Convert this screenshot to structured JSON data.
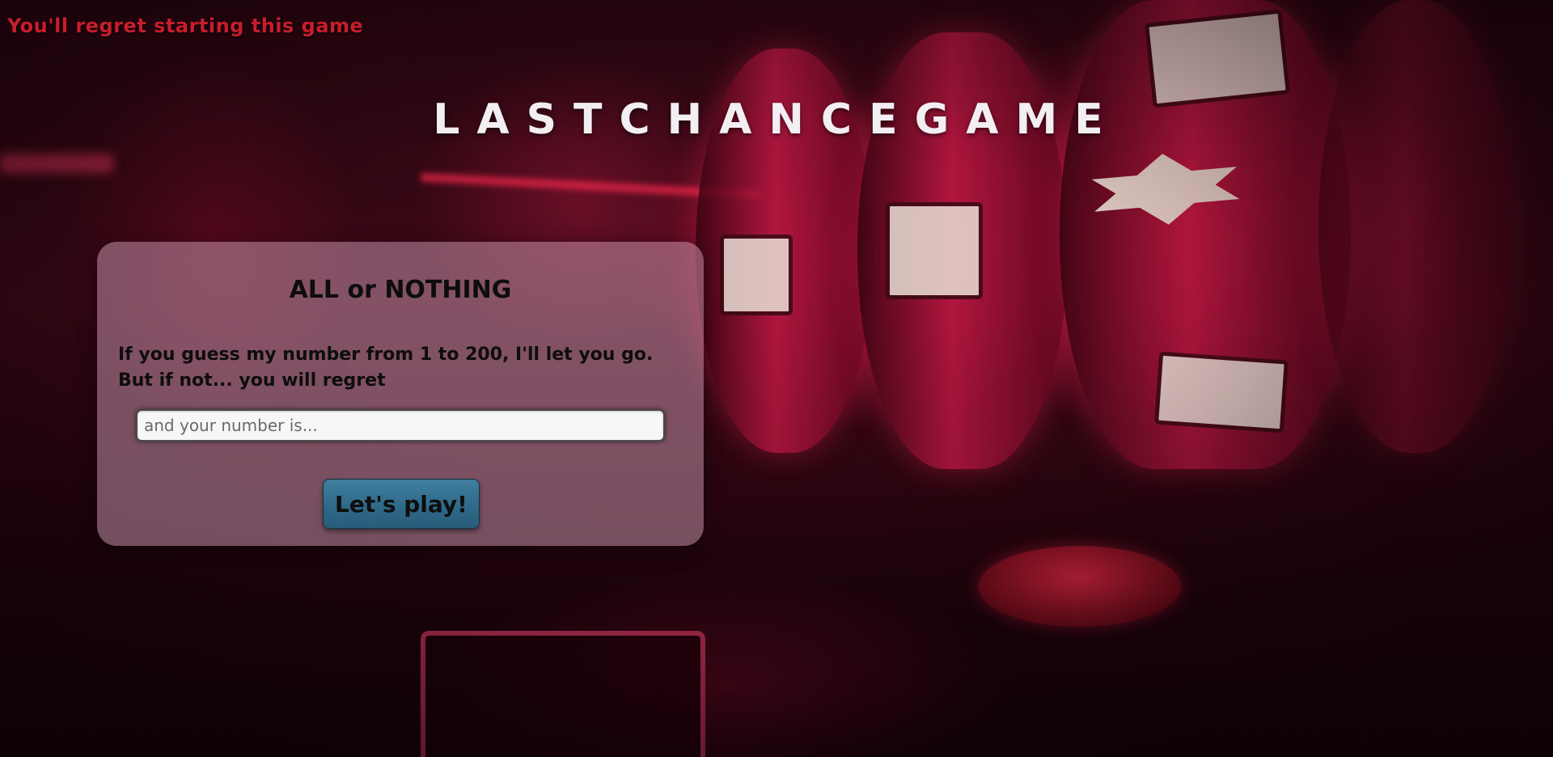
{
  "header": {
    "taunt": "You'll regret starting this game",
    "brand": "LASTCHANCEGAME"
  },
  "card": {
    "title": "ALL or NOTHING",
    "description_line_1": "If you guess my number from 1 to 200, I'll let you go.",
    "description_line_2": "But if not... you will regret",
    "input": {
      "value": "",
      "placeholder": "and your number is..."
    },
    "play_button_label": "Let's play!"
  },
  "colors": {
    "taunt": "#c81d2c",
    "brand": "#f2eef2",
    "card_background": "rgba(200,150,175,0.52)",
    "button": "#2e6887"
  }
}
